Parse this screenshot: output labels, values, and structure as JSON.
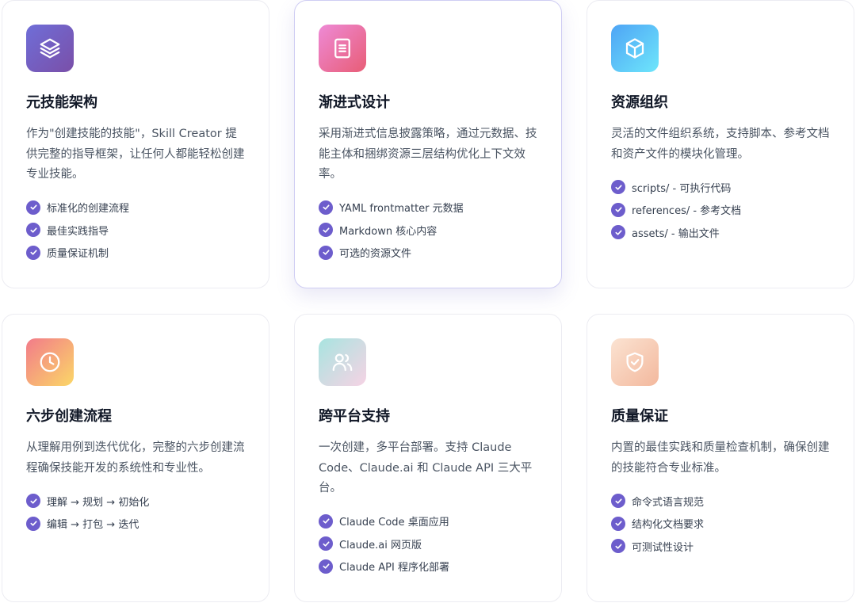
{
  "colors": {
    "check": "#6d5dcc",
    "title": "#111827",
    "text": "#4b5563"
  },
  "cards": [
    {
      "icon": "layers-icon",
      "title": "元技能架构",
      "desc": "作为\"创建技能的技能\"，Skill Creator 提供完整的指导框架，让任何人都能轻松创建专业技能。",
      "features": [
        "标准化的创建流程",
        "最佳实践指导",
        "质量保证机制"
      ]
    },
    {
      "icon": "document-icon",
      "title": "渐进式设计",
      "desc": "采用渐进式信息披露策略，通过元数据、技能主体和捆绑资源三层结构优化上下文效率。",
      "features": [
        "YAML frontmatter 元数据",
        "Markdown 核心内容",
        "可选的资源文件"
      ]
    },
    {
      "icon": "cube-icon",
      "title": "资源组织",
      "desc": "灵活的文件组织系统，支持脚本、参考文档和资产文件的模块化管理。",
      "features": [
        "scripts/ - 可执行代码",
        "references/ - 参考文档",
        "assets/ - 输出文件"
      ]
    },
    {
      "icon": "clock-icon",
      "title": "六步创建流程",
      "desc": "从理解用例到迭代优化，完整的六步创建流程确保技能开发的系统性和专业性。",
      "features": [
        "理解 → 规划 → 初始化",
        "编辑 → 打包 → 迭代"
      ]
    },
    {
      "icon": "users-icon",
      "title": "跨平台支持",
      "desc": "一次创建，多平台部署。支持 Claude Code、Claude.ai 和 Claude API 三大平台。",
      "features": [
        "Claude Code 桌面应用",
        "Claude.ai 网页版",
        "Claude API 程序化部署"
      ]
    },
    {
      "icon": "shield-check-icon",
      "title": "质量保证",
      "desc": "内置的最佳实践和质量检查机制，确保创建的技能符合专业标准。",
      "features": [
        "命令式语言规范",
        "结构化文档要求",
        "可测试性设计"
      ]
    }
  ]
}
